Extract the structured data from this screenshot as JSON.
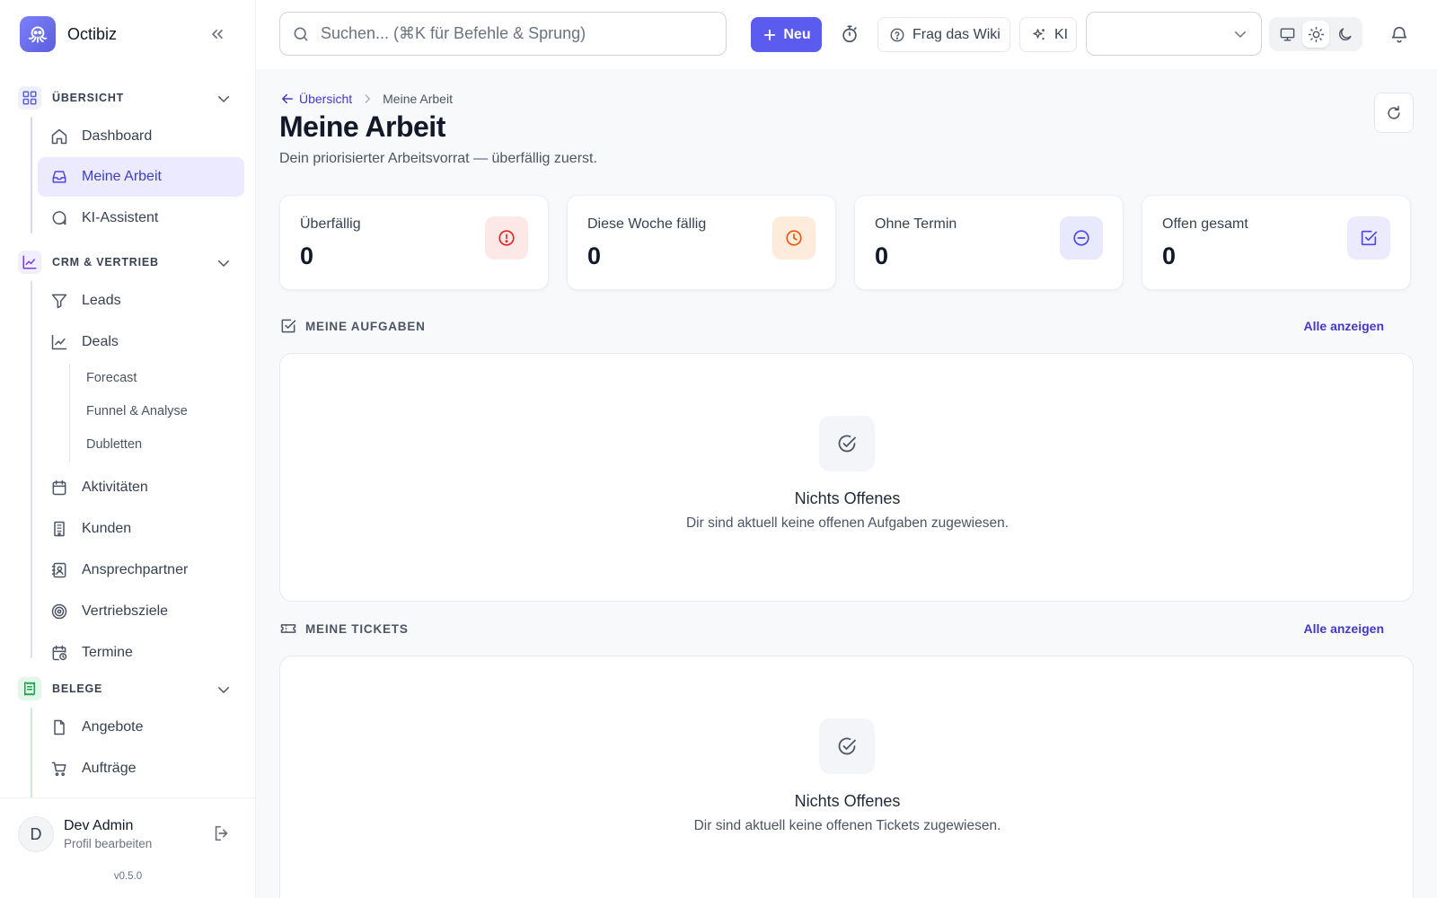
{
  "app": {
    "name": "Octibiz",
    "version": "v0.5.0"
  },
  "sidebar": {
    "sections": [
      {
        "label": "ÜBERSICHT",
        "items": [
          {
            "label": "Dashboard",
            "icon": "home-icon"
          },
          {
            "label": "Meine Arbeit",
            "icon": "inbox-icon",
            "active": true
          },
          {
            "label": "KI-Assistent",
            "icon": "chat-icon"
          }
        ]
      },
      {
        "label": "CRM & VERTRIEB",
        "items": [
          {
            "label": "Leads",
            "icon": "funnel-icon"
          },
          {
            "label": "Deals",
            "icon": "trend-icon",
            "sub": [
              "Forecast",
              "Funnel & Analyse",
              "Dubletten"
            ]
          },
          {
            "label": "Aktivitäten",
            "icon": "calendar-icon"
          },
          {
            "label": "Kunden",
            "icon": "building-icon"
          },
          {
            "label": "Ansprechpartner",
            "icon": "contact-icon"
          },
          {
            "label": "Vertriebsziele",
            "icon": "target-icon"
          },
          {
            "label": "Termine",
            "icon": "calendar-clock-icon"
          }
        ]
      },
      {
        "label": "BELEGE",
        "items": [
          {
            "label": "Angebote",
            "icon": "file-icon"
          },
          {
            "label": "Aufträge",
            "icon": "cart-icon"
          }
        ]
      }
    ],
    "user": {
      "initial": "D",
      "name": "Dev Admin",
      "profile_link": "Profil bearbeiten"
    }
  },
  "topbar": {
    "search_placeholder": "Suchen... (⌘K für Befehle & Sprung)",
    "new_label": "Neu",
    "wiki_label": "Frag das Wiki",
    "ai_label": "KI",
    "select_value": "",
    "theme_options": [
      "monitor-icon",
      "sun-icon",
      "moon-icon"
    ],
    "theme_selected": "sun-icon"
  },
  "main": {
    "breadcrumb": {
      "back": "Übersicht",
      "current": "Meine Arbeit"
    },
    "title": "Meine Arbeit",
    "subtitle": "Dein priorisierter Arbeitsvorrat — überfällig zuerst.",
    "stats": [
      {
        "label": "Überfällig",
        "value": "0",
        "icon": "alert-circle-icon",
        "color": "#dc2626",
        "bg": "#fde8e8"
      },
      {
        "label": "Diese Woche fällig",
        "value": "0",
        "icon": "clock-icon",
        "color": "#ea580c",
        "bg": "#fdebdc"
      },
      {
        "label": "Ohne Termin",
        "value": "0",
        "icon": "minus-circle-icon",
        "color": "#4f46e5",
        "bg": "#e8e9fc"
      },
      {
        "label": "Offen gesamt",
        "value": "0",
        "icon": "check-square-icon",
        "color": "#4f46e5",
        "bg": "#ebebfd"
      }
    ],
    "tasks": {
      "heading": "MEINE AUFGABEN",
      "link": "Alle anzeigen",
      "empty_title": "Nichts Offenes",
      "empty_text": "Dir sind aktuell keine offenen Aufgaben zugewiesen."
    },
    "tickets": {
      "heading": "MEINE TICKETS",
      "link": "Alle anzeigen",
      "empty_title": "Nichts Offenes",
      "empty_text": "Dir sind aktuell keine offenen Tickets zugewiesen."
    }
  }
}
